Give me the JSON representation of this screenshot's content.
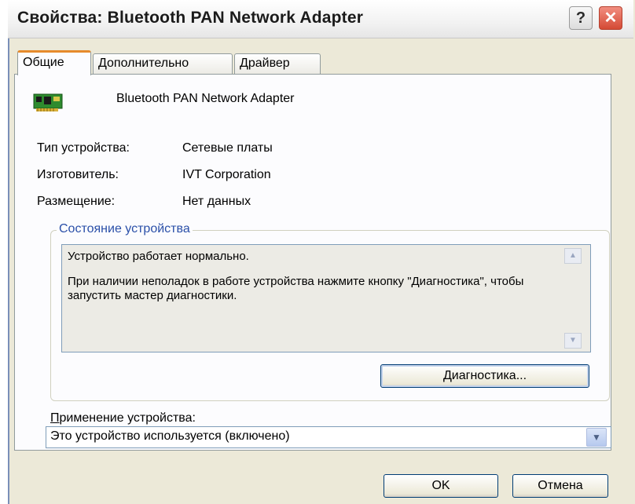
{
  "window": {
    "title": "Свойства: Bluetooth PAN Network Adapter",
    "help_icon": "question-mark-icon",
    "close_icon": "close-x-icon"
  },
  "tabs": [
    {
      "label": "Общие",
      "active": true
    },
    {
      "label": "Дополнительно",
      "active": false
    },
    {
      "label": "Драйвер",
      "active": false
    }
  ],
  "device": {
    "icon": "network-card-icon",
    "name": "Bluetooth PAN Network Adapter"
  },
  "properties": [
    {
      "label": "Тип устройства:",
      "value": "Сетевые платы"
    },
    {
      "label": "Изготовитель:",
      "value": "IVT Corporation"
    },
    {
      "label": "Размещение:",
      "value": "Нет данных"
    }
  ],
  "status": {
    "group_title": "Состояние устройства",
    "line1": "Устройство работает нормально.",
    "line2": "При наличии неполадок в работе устройства нажмите кнопку \"Диагностика\", чтобы запустить мастер диагностики.",
    "diagnostics_button_underlined": "Д",
    "diagnostics_button_rest": "иагностика..."
  },
  "usage": {
    "label_underlined": "П",
    "label_rest": "рименение устройства:",
    "selected_value": "Это устройство используется (включено)"
  },
  "footer": {
    "ok_label": "OK",
    "cancel_label": "Отмена"
  },
  "colors": {
    "dialog_bg": "#ece9d8",
    "active_tab_accent": "#e68b2c",
    "group_title": "#2a4fa8",
    "close_button": "#d44a35"
  }
}
